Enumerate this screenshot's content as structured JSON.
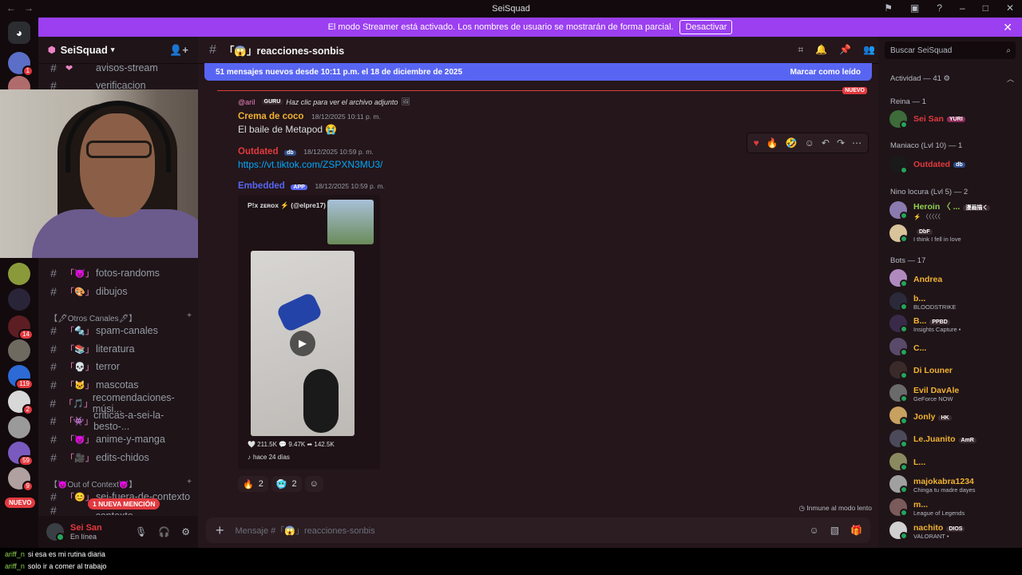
{
  "window": {
    "title": "SeiSquad"
  },
  "banner": {
    "text": "El modo Streamer está activado. Los nombres de usuario se mostrarán de forma parcial.",
    "button": "Desactivar"
  },
  "server": {
    "name": "SeiSquad"
  },
  "guild_badges": [
    "1",
    "14",
    "119",
    "2",
    "59",
    "9"
  ],
  "nuevo_pill": "NUEVO",
  "channels_top": [
    {
      "emoji": "❤",
      "name": "avisos-stream"
    },
    {
      "emoji": "",
      "name": "verificacion"
    }
  ],
  "channels_mid": [
    {
      "emoji": "「😈」",
      "name": "fotos-randoms"
    },
    {
      "emoji": "「🎨」",
      "name": "dibujos"
    }
  ],
  "category_otros": "【🖋Otros Canales🖋】",
  "channels_otros": [
    {
      "emoji": "「🔩」",
      "name": "spam-canales"
    },
    {
      "emoji": "「📚」",
      "name": "literatura"
    },
    {
      "emoji": "「💀」",
      "name": "terror"
    },
    {
      "emoji": "「🐱」",
      "name": "mascotas"
    },
    {
      "emoji": "「🎵」",
      "name": "recomendaciones-músi..."
    },
    {
      "emoji": "「👾」",
      "name": "criticas-a-sei-la-besto-..."
    },
    {
      "emoji": "「😈」",
      "name": "anime-y-manga"
    },
    {
      "emoji": "「🎥」",
      "name": "edits-chidos"
    }
  ],
  "category_ooc": "【😈Out of Context😈】",
  "channels_ooc": [
    {
      "emoji": "「😊」",
      "name": "sei-fuera-de-contexto"
    },
    {
      "emoji": "",
      "name": "chat-fuera-de-contexto"
    }
  ],
  "mention_pill": "1 NUEVA MENCIÓN",
  "user": {
    "name": "Sei San",
    "status": "En línea"
  },
  "channel": {
    "name": "「😱」reacciones-sonbis"
  },
  "new_messages": {
    "text": "51 mensajes nuevos desde 10:11 p.m. el 18 de diciembre de 2025",
    "action": "Marcar como leído"
  },
  "nuevo_tag": "NUEVO",
  "reply_preview": {
    "author": "@ariI",
    "tag": "GURU",
    "text": "Haz clic para ver el archivo adjunto"
  },
  "messages": [
    {
      "author": "Crema de coco",
      "color": "#f0b232",
      "time": "18/12/2025 10:11 p. m.",
      "text": "El baile de Metapod 😭"
    },
    {
      "author": "Outdated",
      "color": "#e23a3f",
      "tag": "db",
      "time": "18/12/2025 10:59 p. m.",
      "text": "https://vt.tiktok.com/ZSPXN3MU3/"
    },
    {
      "author": "Embedded",
      "color": "#5865f2",
      "tag": "APP",
      "time": "18/12/2025 10:59 p. m.",
      "text": ""
    }
  ],
  "embed": {
    "author": "P!x zᴇʀᴏx ⚡ (@elpre17)",
    "stats": "🤍 211.5K  💬 9.47K  ➦ 142.5K",
    "age": "hace 24 días"
  },
  "reactions": [
    {
      "emoji": "🔥",
      "count": "2"
    },
    {
      "emoji": "🥶",
      "count": "2"
    }
  ],
  "inmune": "Inmune al modo lento",
  "composer": {
    "placeholder": "Mensaje #「😱」reacciones-sonbis"
  },
  "search": {
    "placeholder": "Buscar SeiSquad"
  },
  "members_header": "Actividad — 41",
  "member_sections": [
    {
      "title": "Reina — 1",
      "members": [
        {
          "name": "Sei San",
          "color": "#e23a3f",
          "tag": "YURI",
          "sub": ""
        }
      ]
    },
    {
      "title": "Maniaco (Lvl 10) — 1",
      "members": [
        {
          "name": "Outdated",
          "color": "#e23a3f",
          "tag": "db",
          "sub": ""
        }
      ]
    },
    {
      "title": "Nino locura (Lvl 5) — 2",
      "members": [
        {
          "name": "Heroin 〈 ...",
          "color": "#8fd14f",
          "tag": "漫画描く",
          "sub": "⚡ 〈〈〈〈〈"
        },
        {
          "name": "",
          "color": "#dbdee1",
          "tag": "DbF",
          "sub": "I think I fell in love"
        }
      ]
    },
    {
      "title": "Bots — 17",
      "members": [
        {
          "name": "Andrea",
          "color": "#f0b232",
          "tag": "",
          "sub": ""
        },
        {
          "name": "b...",
          "color": "#f0b232",
          "tag": "",
          "sub": "BLOODSTRIKE"
        },
        {
          "name": "B...",
          "color": "#f0b232",
          "tag": "PPBD",
          "sub": "Insights Capture •"
        },
        {
          "name": "C...",
          "color": "#f0b232",
          "tag": "",
          "sub": ""
        },
        {
          "name": "Di Louner",
          "color": "#f0b232",
          "tag": "",
          "sub": ""
        },
        {
          "name": "Evil DavAle",
          "color": "#f0b232",
          "tag": "",
          "sub": "GeForce NOW"
        },
        {
          "name": "Jonly",
          "color": "#f0b232",
          "tag": "HK",
          "sub": ""
        },
        {
          "name": "Le.Juanito",
          "color": "#f0b232",
          "tag": "AmR",
          "sub": ""
        },
        {
          "name": "L...",
          "color": "#f0b232",
          "tag": "",
          "sub": ""
        },
        {
          "name": "majokabra1234",
          "color": "#f0b232",
          "tag": "",
          "sub": "Chinga tu madre dayes"
        },
        {
          "name": "m...",
          "color": "#f0b232",
          "tag": "",
          "sub": "League of Legends"
        },
        {
          "name": "nachito",
          "color": "#f0b232",
          "tag": "DIOS",
          "sub": "VALORANT •"
        }
      ]
    }
  ],
  "chat": [
    {
      "user": "ariff_n",
      "text": "si esa es mi rutina diaria"
    },
    {
      "user": "ariff_n",
      "text": "solo ir a comer al trabajo"
    }
  ]
}
